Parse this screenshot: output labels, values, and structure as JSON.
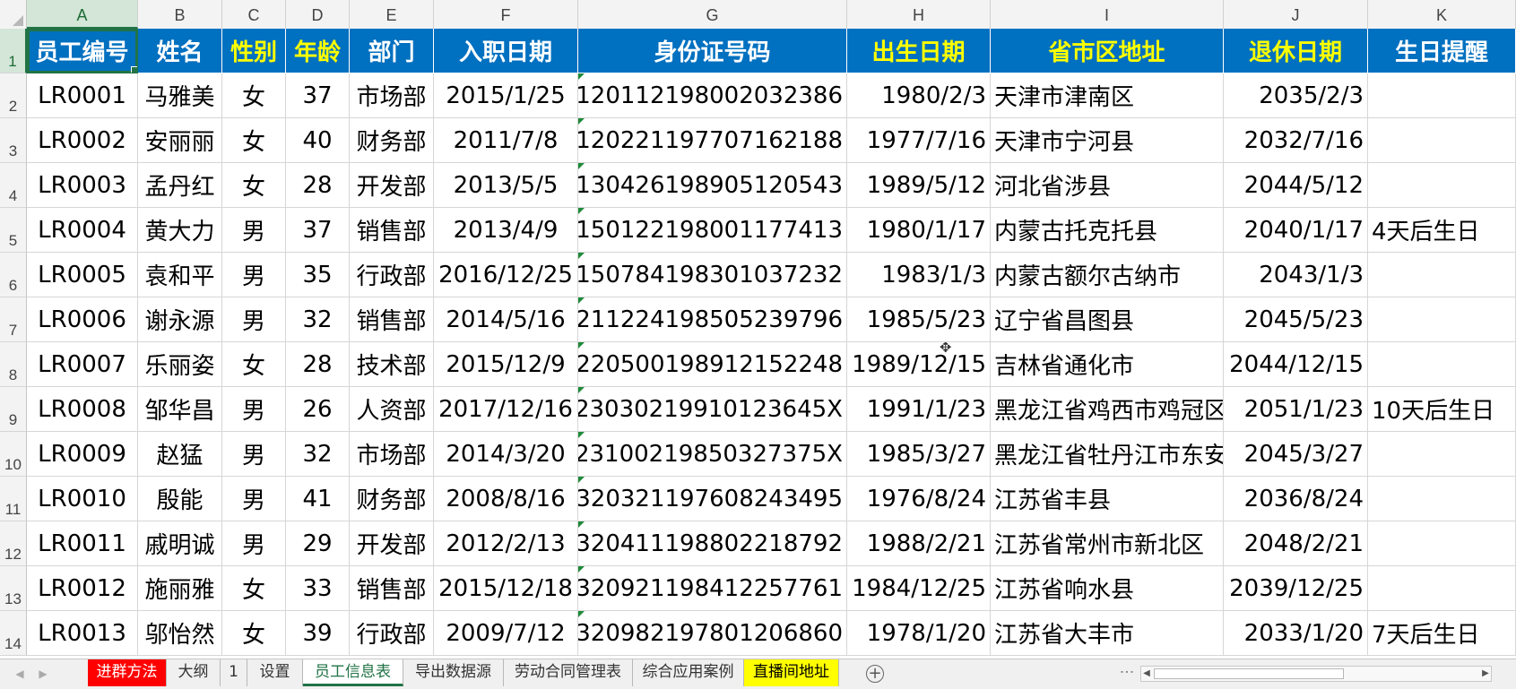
{
  "columns": [
    "A",
    "B",
    "C",
    "D",
    "E",
    "F",
    "G",
    "H",
    "I",
    "J",
    "K"
  ],
  "rows": [
    "1",
    "2",
    "3",
    "4",
    "5",
    "6",
    "7",
    "8",
    "9",
    "10",
    "11",
    "12",
    "13",
    "14"
  ],
  "headers": [
    {
      "text": "员工编号",
      "yellow": false
    },
    {
      "text": "姓名",
      "yellow": false
    },
    {
      "text": "性别",
      "yellow": true
    },
    {
      "text": "年龄",
      "yellow": true
    },
    {
      "text": "部门",
      "yellow": false
    },
    {
      "text": "入职日期",
      "yellow": false
    },
    {
      "text": "身份证号码",
      "yellow": false
    },
    {
      "text": "出生日期",
      "yellow": true
    },
    {
      "text": "省市区地址",
      "yellow": true
    },
    {
      "text": "退休日期",
      "yellow": true
    },
    {
      "text": "生日提醒",
      "yellow": false
    }
  ],
  "records": [
    [
      "LR0001",
      "马雅美",
      "女",
      "37",
      "市场部",
      "2015/1/25",
      "120112198002032386",
      "1980/2/3",
      "天津市津南区",
      "2035/2/3",
      ""
    ],
    [
      "LR0002",
      "安丽丽",
      "女",
      "40",
      "财务部",
      "2011/7/8",
      "120221197707162188",
      "1977/7/16",
      "天津市宁河县",
      "2032/7/16",
      ""
    ],
    [
      "LR0003",
      "孟丹红",
      "女",
      "28",
      "开发部",
      "2013/5/5",
      "130426198905120543",
      "1989/5/12",
      "河北省涉县",
      "2044/5/12",
      ""
    ],
    [
      "LR0004",
      "黄大力",
      "男",
      "37",
      "销售部",
      "2013/4/9",
      "150122198001177413",
      "1980/1/17",
      "内蒙古托克托县",
      "2040/1/17",
      "4天后生日"
    ],
    [
      "LR0005",
      "袁和平",
      "男",
      "35",
      "行政部",
      "2016/12/25",
      "150784198301037232",
      "1983/1/3",
      "内蒙古额尔古纳市",
      "2043/1/3",
      ""
    ],
    [
      "LR0006",
      "谢永源",
      "男",
      "32",
      "销售部",
      "2014/5/16",
      "211224198505239796",
      "1985/5/23",
      "辽宁省昌图县",
      "2045/5/23",
      ""
    ],
    [
      "LR0007",
      "乐丽姿",
      "女",
      "28",
      "技术部",
      "2015/12/9",
      "220500198912152248",
      "1989/12/15",
      "吉林省通化市",
      "2044/12/15",
      ""
    ],
    [
      "LR0008",
      "邹华昌",
      "男",
      "26",
      "人资部",
      "2017/12/16",
      "23030219910123645X",
      "1991/1/23",
      "黑龙江省鸡西市鸡冠区",
      "2051/1/23",
      "10天后生日"
    ],
    [
      "LR0009",
      "赵猛",
      "男",
      "32",
      "市场部",
      "2014/3/20",
      "23100219850327375X",
      "1985/3/27",
      "黑龙江省牡丹江市东安区",
      "2045/3/27",
      ""
    ],
    [
      "LR0010",
      "殷能",
      "男",
      "41",
      "财务部",
      "2008/8/16",
      "320321197608243495",
      "1976/8/24",
      "江苏省丰县",
      "2036/8/24",
      ""
    ],
    [
      "LR0011",
      "戚明诚",
      "男",
      "29",
      "开发部",
      "2012/2/13",
      "320411198802218792",
      "1988/2/21",
      "江苏省常州市新北区",
      "2048/2/21",
      ""
    ],
    [
      "LR0012",
      "施丽雅",
      "女",
      "33",
      "销售部",
      "2015/12/18",
      "320921198412257761",
      "1984/12/25",
      "江苏省响水县",
      "2039/12/25",
      ""
    ],
    [
      "LR0013",
      "邬怡然",
      "女",
      "39",
      "行政部",
      "2009/7/12",
      "320982197801206860",
      "1978/1/20",
      "江苏省大丰市",
      "2033/1/20",
      "7天后生日"
    ]
  ],
  "tabs": [
    {
      "label": "进群方法",
      "style": "red"
    },
    {
      "label": "大纲",
      "style": ""
    },
    {
      "label": "1",
      "style": ""
    },
    {
      "label": "设置",
      "style": ""
    },
    {
      "label": "员工信息表",
      "style": "active"
    },
    {
      "label": "导出数据源",
      "style": ""
    },
    {
      "label": "劳动合同管理表",
      "style": ""
    },
    {
      "label": "综合应用案例",
      "style": ""
    },
    {
      "label": "直播间地址",
      "style": "yellow"
    }
  ],
  "colors": {
    "header_bg": "#0070c0",
    "header_text": "#ffffff",
    "header_highlight": "#ffff00",
    "selection": "#217346"
  },
  "icons": {
    "add_sheet": "plus-circle-icon",
    "cell_cursor": "move-cursor-icon"
  }
}
